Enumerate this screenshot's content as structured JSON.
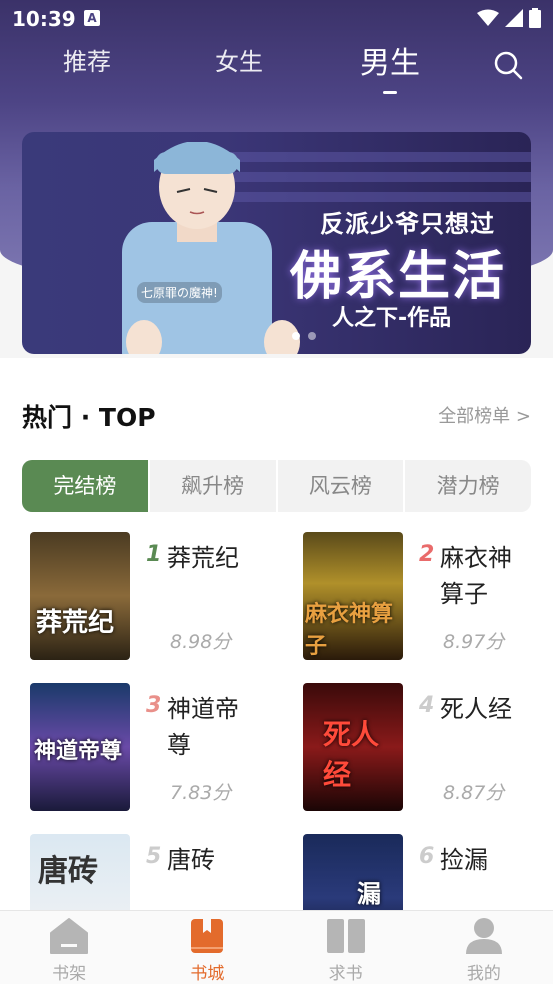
{
  "status": {
    "time": "10:39"
  },
  "top_tabs": [
    {
      "label": "推荐"
    },
    {
      "label": "女生"
    },
    {
      "label": "男生"
    }
  ],
  "banner": {
    "subtitle": "反派少爷只想过",
    "title": "佛系生活",
    "author": "人之下-作品",
    "tag": "七原罪の魔神!"
  },
  "section": {
    "title": "热门 · TOP",
    "see_all": "全部榜单 >"
  },
  "rank_tabs": [
    {
      "label": "完结榜"
    },
    {
      "label": "飙升榜"
    },
    {
      "label": "风云榜"
    },
    {
      "label": "潜力榜"
    }
  ],
  "books": [
    {
      "rank": "1",
      "name": "莽荒纪",
      "score": "8.98分",
      "rank_color": "#5a8a53",
      "cover_text": "莽荒纪"
    },
    {
      "rank": "2",
      "name": "麻衣神算子",
      "score": "8.97分",
      "rank_color": "#e96b6b",
      "cover_text": "麻衣神算子"
    },
    {
      "rank": "3",
      "name": "神道帝尊",
      "score": "7.83分",
      "rank_color": "#e9908a",
      "cover_text": "神道帝尊"
    },
    {
      "rank": "4",
      "name": "死人经",
      "score": "8.87分",
      "rank_color": "#cccccc",
      "cover_text": "死人经"
    },
    {
      "rank": "5",
      "name": "唐砖",
      "score": "",
      "rank_color": "#cccccc",
      "cover_text": "唐砖"
    },
    {
      "rank": "6",
      "name": "捡漏",
      "score": "",
      "rank_color": "#cccccc",
      "cover_text": "漏"
    }
  ],
  "bottom_nav": [
    {
      "label": "书架",
      "icon": "bookshelf-icon"
    },
    {
      "label": "书城",
      "icon": "bookstore-icon"
    },
    {
      "label": "求书",
      "icon": "request-book-icon"
    },
    {
      "label": "我的",
      "icon": "profile-icon"
    }
  ],
  "colors": {
    "accent": "#5a8a53",
    "nav_active": "#e36b2c",
    "header": "#4d4485"
  }
}
